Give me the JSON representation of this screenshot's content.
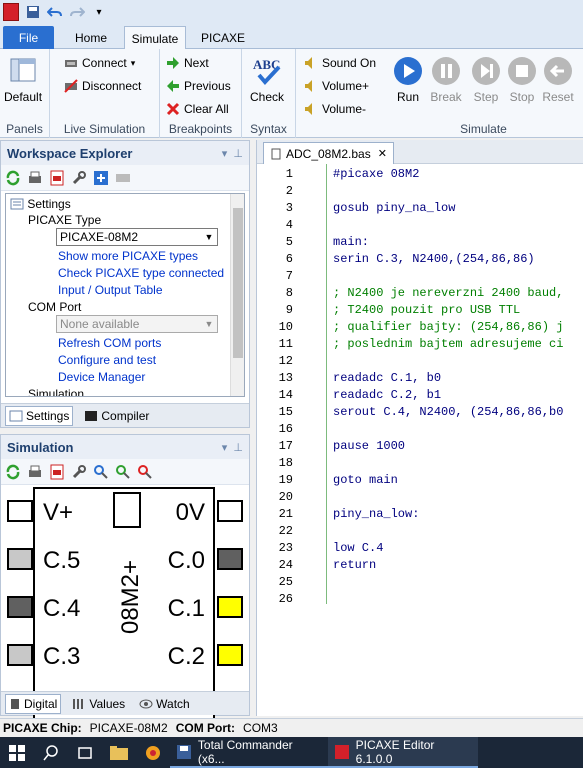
{
  "tabs": {
    "file": "File",
    "home": "Home",
    "simulate": "Simulate",
    "picaxe": "PICAXE"
  },
  "ribbon": {
    "panels": {
      "default": "Default",
      "label": "Panels"
    },
    "live": {
      "connect": "Connect",
      "disconnect": "Disconnect",
      "label": "Live Simulation"
    },
    "breakpoints": {
      "next": "Next",
      "previous": "Previous",
      "clear_all": "Clear All",
      "label": "Breakpoints"
    },
    "syntax": {
      "check": "Check",
      "label": "Syntax"
    },
    "sound": {
      "sound_on": "Sound On",
      "volume_up": "Volume+",
      "volume_down": "Volume-"
    },
    "simulate": {
      "run": "Run",
      "break": "Break",
      "step": "Step",
      "stop": "Stop",
      "reset": "Reset",
      "label": "Simulate"
    }
  },
  "workspace": {
    "title": "Workspace Explorer",
    "tree": {
      "settings": "Settings",
      "picaxe_type": "PICAXE Type",
      "picaxe_value": "PICAXE-08M2",
      "show_more": "Show more PICAXE types",
      "check_type": "Check PICAXE type connected",
      "io_table": "Input / Output Table",
      "com_port": "COM Port",
      "com_value": "None available",
      "refresh": "Refresh COM ports",
      "configure": "Configure and test",
      "device_manager": "Device Manager",
      "simulation": "Simulation"
    },
    "tabs": {
      "settings": "Settings",
      "compiler": "Compiler"
    }
  },
  "simulation": {
    "title": "Simulation",
    "chip_name": "08M2+",
    "pins": {
      "vplus": "V+",
      "ov": "0V",
      "c5": "C.5",
      "c0": "C.0",
      "c4": "C.4",
      "c1": "C.1",
      "c3": "C.3",
      "c2": "C.2"
    },
    "tabs": {
      "digital": "Digital",
      "values": "Values",
      "watch": "Watch"
    }
  },
  "editor": {
    "file_tab": "ADC_08M2.bas",
    "lines": [
      "#picaxe 08M2",
      "",
      "gosub piny_na_low",
      "",
      "main:",
      "serin C.3, N2400,(254,86,86)",
      "",
      "; N2400 je nereverzni 2400 baud,",
      "; T2400 pouzit pro USB TTL",
      "; qualifier bajty: (254,86,86) j",
      "; poslednim bajtem adresujeme ci",
      "",
      "readadc C.1, b0",
      "readadc C.2, b1",
      "serout C.4, N2400, (254,86,86,b0",
      "",
      "pause 1000",
      "",
      "goto main",
      "",
      "piny_na_low:",
      "",
      "low C.4",
      "return",
      "",
      ""
    ],
    "line_numbers": [
      "1",
      "2",
      "3",
      "4",
      "5",
      "6",
      "7",
      "8",
      "9",
      "10",
      "11",
      "12",
      "13",
      "14",
      "15",
      "16",
      "17",
      "18",
      "19",
      "20",
      "21",
      "22",
      "23",
      "24",
      "25",
      "26"
    ]
  },
  "status": {
    "chip_label": "PICAXE Chip:",
    "chip_value": "PICAXE-08M2",
    "port_label": "COM Port:",
    "port_value": "COM3"
  },
  "taskbar": {
    "app1": "Total Commander (x6...",
    "app2": "PICAXE Editor 6.1.0.0"
  },
  "colors": {
    "pin_grey": "#c8c8c8",
    "pin_dark": "#606060",
    "pin_yellow": "#ffff00",
    "accent": "#2a6fd0"
  }
}
